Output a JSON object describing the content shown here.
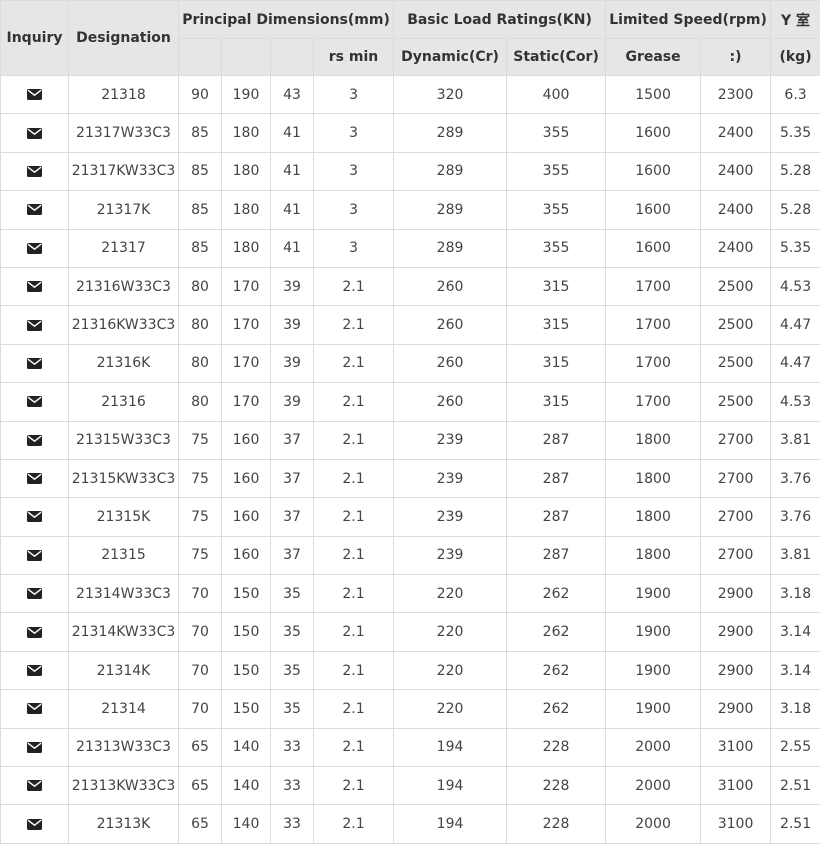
{
  "table": {
    "headers": {
      "inquiry": "Inquiry",
      "designation": "Designation",
      "principal_dimensions": "Principal Dimensions(mm)",
      "rs_min": "rs min",
      "basic_load_ratings": "Basic Load Ratings(KN)",
      "dynamic": "Dynamic(Cr)",
      "static": "Static(Cor)",
      "limited_speed": "Limited Speed(rpm)",
      "grease": "Grease",
      "oil": ":)",
      "weight_top": "Y 室",
      "weight_unit": "(kg)"
    },
    "rows": [
      [
        "21318",
        "90",
        "190",
        "43",
        "3",
        "320",
        "400",
        "1500",
        "2300",
        "6.3"
      ],
      [
        "21317W33C3",
        "85",
        "180",
        "41",
        "3",
        "289",
        "355",
        "1600",
        "2400",
        "5.35"
      ],
      [
        "21317KW33C3",
        "85",
        "180",
        "41",
        "3",
        "289",
        "355",
        "1600",
        "2400",
        "5.28"
      ],
      [
        "21317K",
        "85",
        "180",
        "41",
        "3",
        "289",
        "355",
        "1600",
        "2400",
        "5.28"
      ],
      [
        "21317",
        "85",
        "180",
        "41",
        "3",
        "289",
        "355",
        "1600",
        "2400",
        "5.35"
      ],
      [
        "21316W33C3",
        "80",
        "170",
        "39",
        "2.1",
        "260",
        "315",
        "1700",
        "2500",
        "4.53"
      ],
      [
        "21316KW33C3",
        "80",
        "170",
        "39",
        "2.1",
        "260",
        "315",
        "1700",
        "2500",
        "4.47"
      ],
      [
        "21316K",
        "80",
        "170",
        "39",
        "2.1",
        "260",
        "315",
        "1700",
        "2500",
        "4.47"
      ],
      [
        "21316",
        "80",
        "170",
        "39",
        "2.1",
        "260",
        "315",
        "1700",
        "2500",
        "4.53"
      ],
      [
        "21315W33C3",
        "75",
        "160",
        "37",
        "2.1",
        "239",
        "287",
        "1800",
        "2700",
        "3.81"
      ],
      [
        "21315KW33C3",
        "75",
        "160",
        "37",
        "2.1",
        "239",
        "287",
        "1800",
        "2700",
        "3.76"
      ],
      [
        "21315K",
        "75",
        "160",
        "37",
        "2.1",
        "239",
        "287",
        "1800",
        "2700",
        "3.76"
      ],
      [
        "21315",
        "75",
        "160",
        "37",
        "2.1",
        "239",
        "287",
        "1800",
        "2700",
        "3.81"
      ],
      [
        "21314W33C3",
        "70",
        "150",
        "35",
        "2.1",
        "220",
        "262",
        "1900",
        "2900",
        "3.18"
      ],
      [
        "21314KW33C3",
        "70",
        "150",
        "35",
        "2.1",
        "220",
        "262",
        "1900",
        "2900",
        "3.14"
      ],
      [
        "21314K",
        "70",
        "150",
        "35",
        "2.1",
        "220",
        "262",
        "1900",
        "2900",
        "3.14"
      ],
      [
        "21314",
        "70",
        "150",
        "35",
        "2.1",
        "220",
        "262",
        "1900",
        "2900",
        "3.18"
      ],
      [
        "21313W33C3",
        "65",
        "140",
        "33",
        "2.1",
        "194",
        "228",
        "2000",
        "3100",
        "2.55"
      ],
      [
        "21313KW33C3",
        "65",
        "140",
        "33",
        "2.1",
        "194",
        "228",
        "2000",
        "3100",
        "2.51"
      ],
      [
        "21313K",
        "65",
        "140",
        "33",
        "2.1",
        "194",
        "228",
        "2000",
        "3100",
        "2.51"
      ]
    ]
  },
  "icons": {
    "inquiry": "envelope-icon"
  },
  "colors": {
    "header_bg": "#e6e6e6",
    "border": "#dcdcdc",
    "text": "#333333",
    "icon": "#222222"
  }
}
